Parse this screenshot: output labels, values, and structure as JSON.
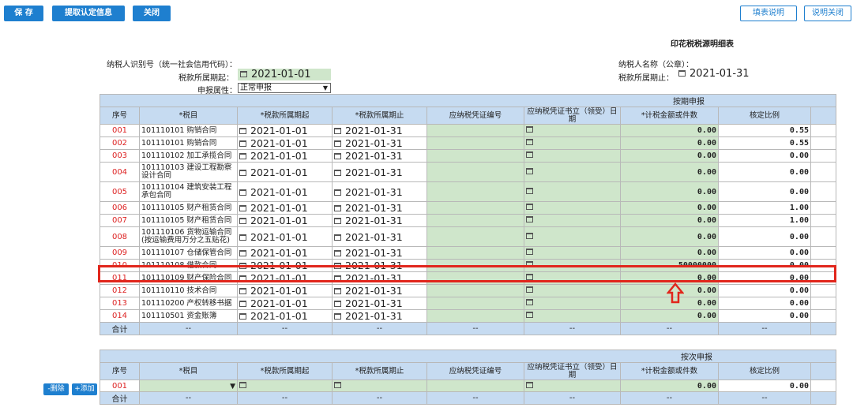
{
  "toolbar": {
    "save": "保 存",
    "fetch": "提取认定信息",
    "close": "关闭"
  },
  "top_right": {
    "help": "填表说明",
    "help_close": "说明关闭"
  },
  "title": "印花税税源明细表",
  "form": {
    "taxpayer_id_label": "纳税人识别号（统一社会信用代码）：",
    "taxpayer_name_label": "纳税人名称（公章）：",
    "period_start_label": "税款所属期起：",
    "period_start": "2021-01-01",
    "period_end_label": "税款所属期止：",
    "period_end": "2021-01-31",
    "attr_label": "申报属性：",
    "attr_value": "正常申报"
  },
  "periodic": {
    "section": "按期申报",
    "headers": [
      "序号",
      "*税目",
      "*税款所属期起",
      "*税款所属期止",
      "应纳税凭证编号",
      "应纳税凭证书立（领受）日期",
      "*计税金额或件数",
      "核定比例"
    ],
    "rows": [
      {
        "no": "001",
        "item": "101110101 购销合同",
        "start": "2021-01-01",
        "end": "2021-01-31",
        "amount": "0.00",
        "ratio": "0.55"
      },
      {
        "no": "002",
        "item": "101110101 购销合同",
        "start": "2021-01-01",
        "end": "2021-01-31",
        "amount": "0.00",
        "ratio": "0.55"
      },
      {
        "no": "003",
        "item": "101110102 加工承揽合同",
        "start": "2021-01-01",
        "end": "2021-01-31",
        "amount": "0.00",
        "ratio": "0.00"
      },
      {
        "no": "004",
        "item": "101110103 建设工程勘察设计合同",
        "start": "2021-01-01",
        "end": "2021-01-31",
        "amount": "0.00",
        "ratio": "0.00"
      },
      {
        "no": "005",
        "item": "101110104 建筑安装工程承包合同",
        "start": "2021-01-01",
        "end": "2021-01-31",
        "amount": "0.00",
        "ratio": "0.00"
      },
      {
        "no": "006",
        "item": "101110105 财产租赁合同",
        "start": "2021-01-01",
        "end": "2021-01-31",
        "amount": "0.00",
        "ratio": "1.00"
      },
      {
        "no": "007",
        "item": "101110105 财产租赁合同",
        "start": "2021-01-01",
        "end": "2021-01-31",
        "amount": "0.00",
        "ratio": "1.00"
      },
      {
        "no": "008",
        "item": "101110106 货物运输合同(按运输费用万分之五贴花)",
        "start": "2021-01-01",
        "end": "2021-01-31",
        "amount": "0.00",
        "ratio": "0.00"
      },
      {
        "no": "009",
        "item": "101110107 仓储保管合同",
        "start": "2021-01-01",
        "end": "2021-01-31",
        "amount": "0.00",
        "ratio": "0.00"
      },
      {
        "no": "010",
        "item": "101110108 借款合同",
        "start": "2021-01-01",
        "end": "2021-01-31",
        "amount": "50000000",
        "ratio": "0.00"
      },
      {
        "no": "011",
        "item": "101110109 财产保险合同",
        "start": "2021-01-01",
        "end": "2021-01-31",
        "amount": "0.00",
        "ratio": "0.00"
      },
      {
        "no": "012",
        "item": "101110110 技术合同",
        "start": "2021-01-01",
        "end": "2021-01-31",
        "amount": "0.00",
        "ratio": "0.00"
      },
      {
        "no": "013",
        "item": "101110200 产权转移书据",
        "start": "2021-01-01",
        "end": "2021-01-31",
        "amount": "0.00",
        "ratio": "0.00"
      },
      {
        "no": "014",
        "item": "101110501 资金账簿",
        "start": "2021-01-01",
        "end": "2021-01-31",
        "amount": "0.00",
        "ratio": "0.00"
      }
    ],
    "sum_label": "合计",
    "sum_dash": "--"
  },
  "per_item": {
    "section": "按次申报",
    "row": {
      "no": "001",
      "amount": "0.00",
      "ratio": "0.00"
    },
    "sum_label": "合计",
    "sum_dash": "--",
    "delete": "-删除",
    "add": "+添加"
  },
  "colors": {
    "accent": "#1e7fcf",
    "header_bg": "#c6dbf1",
    "input_bg": "#cfe6cb",
    "highlight": "#e1261c"
  }
}
